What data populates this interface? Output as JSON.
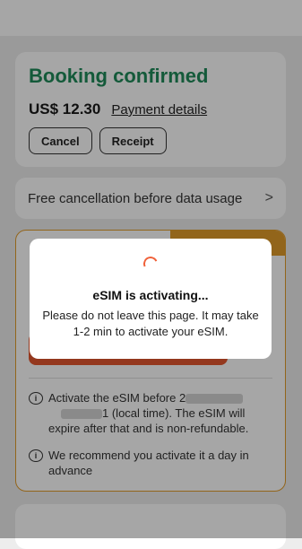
{
  "booking": {
    "title": "Booking confirmed",
    "price": "US$ 12.30",
    "payment_link": "Payment details",
    "cancel_label": "Cancel",
    "receipt_label": "Receipt"
  },
  "cancellation": {
    "text": "Free cancellation before data usage",
    "chevron": ">"
  },
  "activation": {
    "notes": [
      {
        "before": "Activate the eSIM before ",
        "partial": "2",
        "after": " (local time). The eSIM will expire after that and is non-refundable.",
        "mid": "1"
      },
      {
        "text": "We recommend you activate it a day in advance"
      }
    ]
  },
  "modal": {
    "title": "eSIM is activating...",
    "body": "Please do not leave this page. It may take 1-2 min to activate your eSIM."
  },
  "colors": {
    "brand_green": "#1f8a5a",
    "accent_orange": "#e19b2a",
    "button_red": "#e4572e"
  },
  "icons": {
    "info": "info-icon",
    "spinner": "loading-spinner-icon",
    "chevron": "chevron-right-icon"
  }
}
